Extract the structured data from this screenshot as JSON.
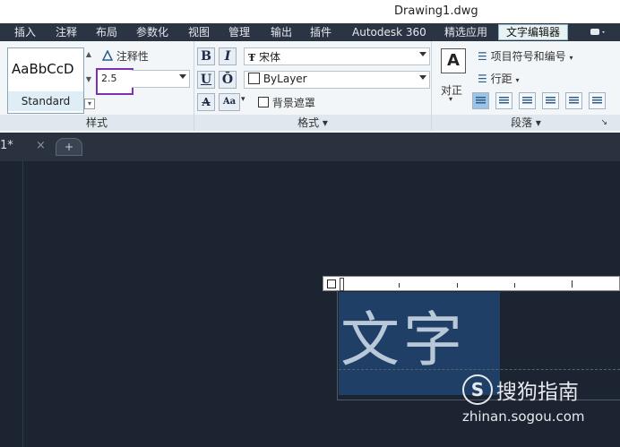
{
  "window": {
    "title": "Drawing1.dwg"
  },
  "menu_tabs": [
    {
      "label": "插入",
      "active": false
    },
    {
      "label": "注释",
      "active": false
    },
    {
      "label": "布局",
      "active": false
    },
    {
      "label": "参数化",
      "active": false
    },
    {
      "label": "视图",
      "active": false
    },
    {
      "label": "管理",
      "active": false
    },
    {
      "label": "输出",
      "active": false
    },
    {
      "label": "插件",
      "active": false
    },
    {
      "label": "Autodesk 360",
      "active": false
    },
    {
      "label": "精选应用",
      "active": false
    },
    {
      "label": "文字编辑器",
      "active": true
    }
  ],
  "style_panel": {
    "preview_text": "AaBbCcD",
    "style_name": "Standard",
    "annotative_label": "注释性",
    "text_height": "2.5",
    "panel_title": "样式"
  },
  "format_panel": {
    "bold": "B",
    "italic": "I",
    "underline": "U",
    "overline": "Ō",
    "font_value": "宋体",
    "color_value": "ByLayer",
    "strike": "A",
    "case": "Aa",
    "background_mask": "背景遮罩",
    "panel_title": "格式 ▾"
  },
  "paragraph_panel": {
    "justify_label": "对正",
    "bullets_label": "项目符号和编号",
    "line_spacing_label": "行距",
    "panel_title": "段落 ▾",
    "expand_glyph": "↘"
  },
  "doc_tabs": {
    "current": "1*",
    "close_glyph": "×",
    "new_tab_glyph": "+"
  },
  "editor": {
    "text": "文字"
  },
  "watermark": {
    "brand": "搜狗指南",
    "url": "zhinan.sogou.com"
  },
  "colors": {
    "accent_highlight": "#7d2fb5",
    "canvas_bg": "#1d2431",
    "text_bg": "#1f3f66"
  }
}
